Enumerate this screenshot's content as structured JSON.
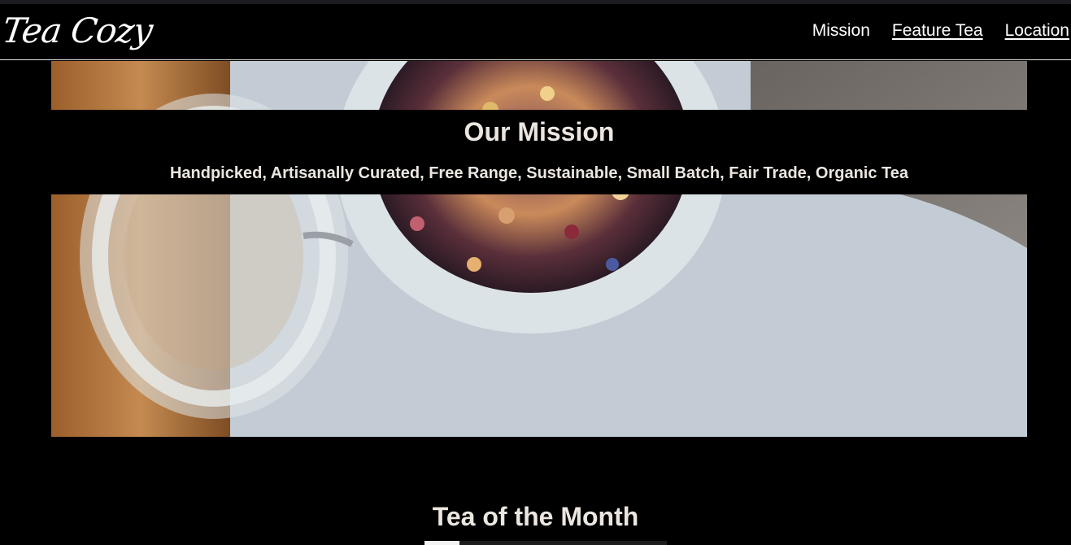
{
  "brand": {
    "logo_text": "Tea Cozy"
  },
  "nav": {
    "items": [
      {
        "label": "Mission"
      },
      {
        "label": "Feature Tea"
      },
      {
        "label": "Location"
      }
    ]
  },
  "mission": {
    "title": "Our Mission",
    "subtitle": "Handpicked, Artisanally Curated, Free Range, Sustainable, Small Batch, Fair Trade, Organic Tea"
  },
  "tea_of_month": {
    "title": "Tea of the Month"
  },
  "colors": {
    "background": "#000000",
    "text": "#ece6e0",
    "nav_text": "#ffffff",
    "header_border": "#eae4de"
  }
}
